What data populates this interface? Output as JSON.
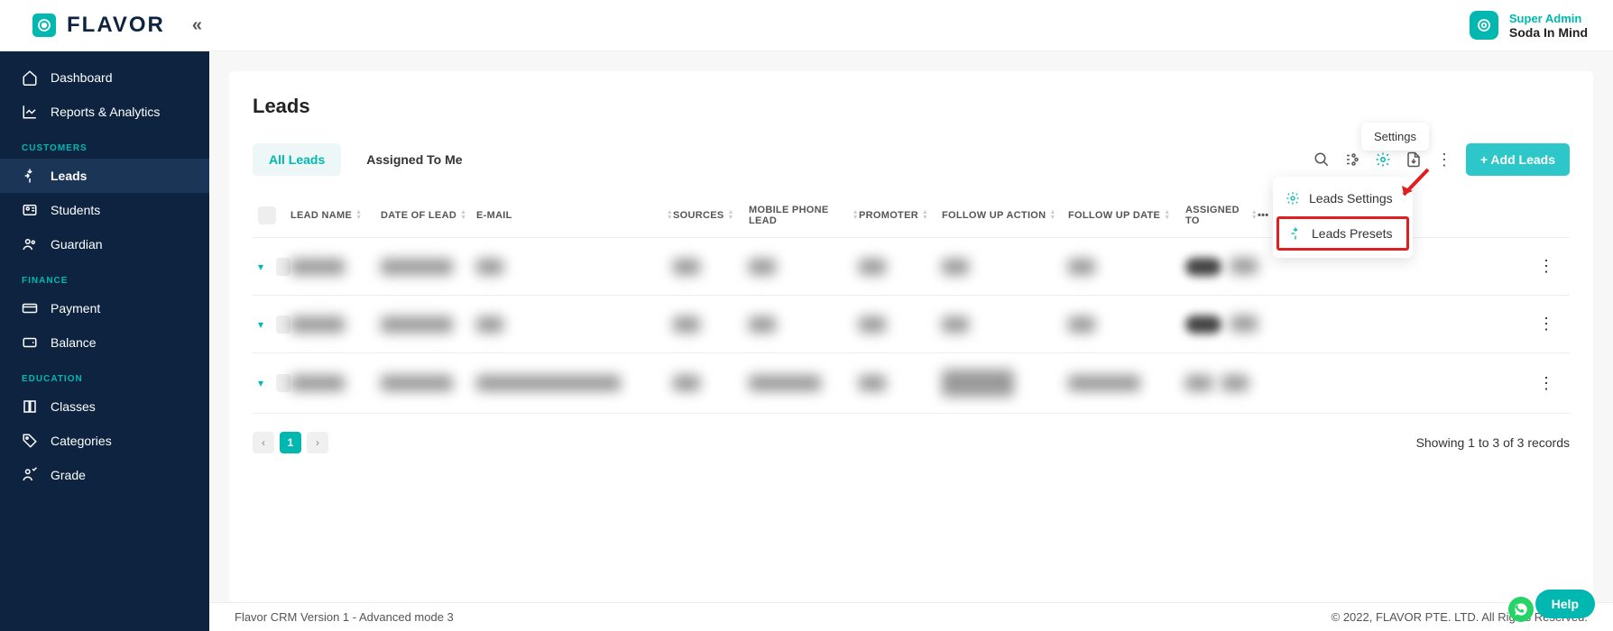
{
  "header": {
    "brand": "FLAVOR",
    "user_role": "Super Admin",
    "user_name": "Soda In Mind"
  },
  "sidebar": {
    "items": [
      {
        "label": "Dashboard"
      },
      {
        "label": "Reports & Analytics"
      }
    ],
    "section_customers": "CUSTOMERS",
    "customers": [
      {
        "label": "Leads"
      },
      {
        "label": "Students"
      },
      {
        "label": "Guardian"
      }
    ],
    "section_finance": "FINANCE",
    "finance": [
      {
        "label": "Payment"
      },
      {
        "label": "Balance"
      }
    ],
    "section_education": "EDUCATION",
    "education": [
      {
        "label": "Classes"
      },
      {
        "label": "Categories"
      },
      {
        "label": "Grade"
      }
    ]
  },
  "page": {
    "title": "Leads",
    "tabs": [
      {
        "label": "All Leads",
        "active": true
      },
      {
        "label": "Assigned To Me",
        "active": false
      }
    ],
    "add_button": "+ Add Leads"
  },
  "table": {
    "headers": [
      "LEAD NAME",
      "DATE OF LEAD",
      "E-MAIL",
      "SOURCES",
      "MOBILE PHONE LEAD",
      "PROMOTER",
      "FOLLOW UP ACTION",
      "FOLLOW UP DATE",
      "ASSIGNED TO"
    ]
  },
  "pagination": {
    "current": "1",
    "summary": "Showing 1 to 3 of 3 records"
  },
  "tooltip": {
    "label": "Settings"
  },
  "dropdown": {
    "item1": "Leads Settings",
    "item2": "Leads Presets"
  },
  "footer": {
    "left": "Flavor CRM Version 1 - Advanced mode 3",
    "right": "© 2022, FLAVOR PTE. LTD. All Rights Reserved."
  },
  "help": {
    "label": "Help"
  }
}
